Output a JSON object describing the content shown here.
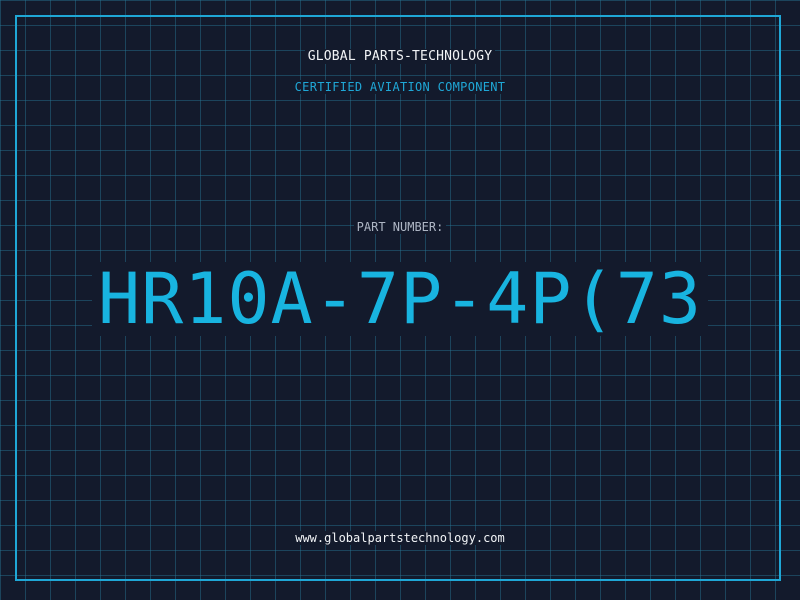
{
  "header": {
    "company": "GLOBAL PARTS-TECHNOLOGY",
    "subtitle": "CERTIFIED AVIATION COMPONENT"
  },
  "main": {
    "label": "PART NUMBER:",
    "part_number": "HR10A-7P-4P(73"
  },
  "footer": {
    "url": "www.globalpartstechnology.com"
  },
  "colors": {
    "background": "#131a2c",
    "accent": "#18b4e0",
    "grid": "#28789a",
    "text": "#f2f4f7"
  }
}
